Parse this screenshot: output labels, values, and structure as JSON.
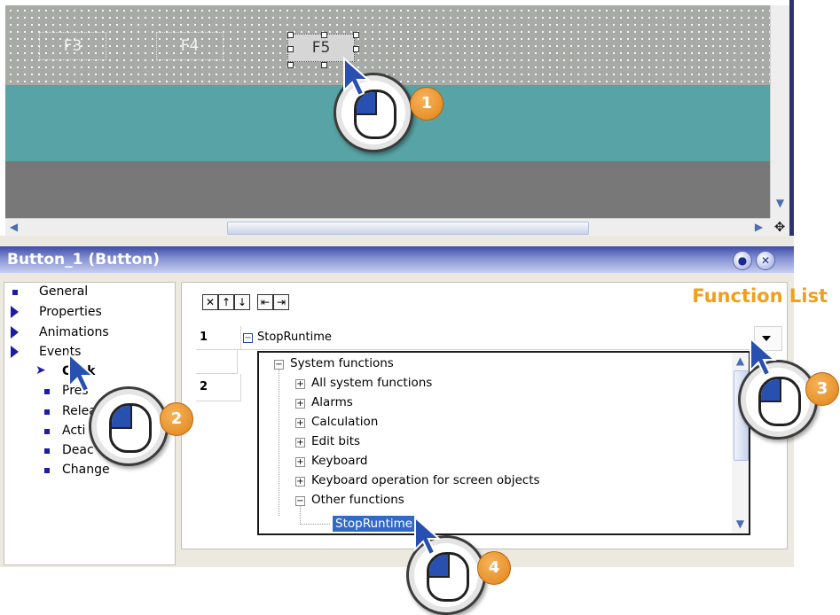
{
  "editor": {
    "buttons": [
      "F3",
      "F4",
      "F5"
    ]
  },
  "panel": {
    "title": "Button_1 (Button)",
    "pin_icon": "pin-icon",
    "close_icon": "close-icon"
  },
  "nav": {
    "items": [
      {
        "label": "General"
      },
      {
        "label": "Properties"
      },
      {
        "label": "Animations"
      },
      {
        "label": "Events"
      }
    ],
    "events": [
      {
        "label": "Click"
      },
      {
        "label": "Pres"
      },
      {
        "label": "Relea"
      },
      {
        "label": "Acti"
      },
      {
        "label": "Deac"
      },
      {
        "label": "Change"
      }
    ]
  },
  "function_list": {
    "title": "Function List",
    "rows": [
      "1",
      "2"
    ],
    "function_name": "StopRuntime",
    "toolbar": [
      "delete-icon",
      "move-up-icon",
      "move-down-icon",
      "outdent-icon",
      "indent-icon"
    ]
  },
  "dropdown": {
    "root": "System functions",
    "items": [
      "All system functions",
      "Alarms",
      "Calculation",
      "Edit bits",
      "Keyboard",
      "Keyboard operation for screen objects",
      "Other functions"
    ],
    "selected": "StopRuntime"
  },
  "callouts": [
    "1",
    "2",
    "3",
    "4"
  ],
  "colors": {
    "accent_orange": "#f0a01c",
    "selection_blue": "#316ac5",
    "title_bar": "#3e4aa6",
    "teal": "#57a3a5"
  }
}
